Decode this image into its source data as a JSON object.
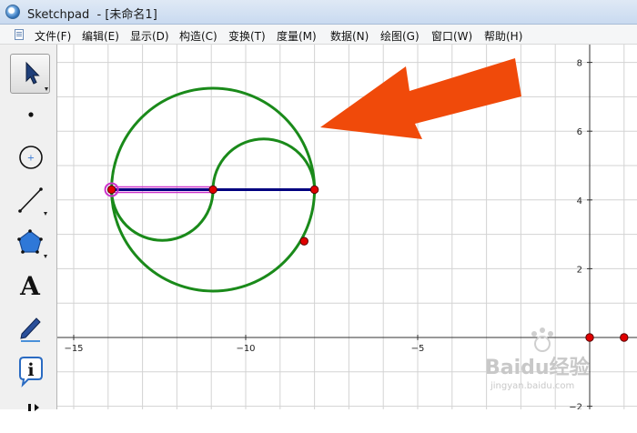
{
  "window": {
    "title": "Sketchpad  - [未命名1]"
  },
  "menu": {
    "items": [
      "文件(F)",
      "编辑(E)",
      "显示(D)",
      "构造(C)",
      "变换(T)",
      "度量(M)",
      "数据(N)",
      "绘图(G)",
      "窗口(W)",
      "帮助(H)"
    ]
  },
  "toolbox": {
    "tools": [
      {
        "name": "selection-arrow-tool",
        "icon": "arrow-icon",
        "selected": true
      },
      {
        "name": "point-tool",
        "icon": "point-icon"
      },
      {
        "name": "compass-tool",
        "icon": "circle-icon"
      },
      {
        "name": "straightedge-tool",
        "icon": "segment-icon"
      },
      {
        "name": "polygon-tool",
        "icon": "pentagon-icon"
      },
      {
        "name": "text-tool",
        "icon": "text-icon",
        "label": "A"
      },
      {
        "name": "marker-tool",
        "icon": "marker-icon"
      },
      {
        "name": "information-tool",
        "icon": "info-icon",
        "label": "i"
      },
      {
        "name": "custom-tool",
        "icon": "custom-tool-icon"
      }
    ]
  },
  "graph": {
    "x_ticks": [
      -15,
      -10,
      -5
    ],
    "x_tick_labels": [
      "−15",
      "−10",
      "−5"
    ],
    "y_ticks": [
      8,
      6,
      4,
      2,
      -2
    ],
    "y_tick_labels": [
      "8",
      "6",
      "4",
      "2",
      "−2"
    ],
    "grid": true,
    "colors": {
      "circle": "#1a8a1a",
      "segment": "#000080",
      "point": "#e00000",
      "arrow": "#f04a0a",
      "selected_highlight": "#cc33cc"
    }
  },
  "watermark": {
    "brand": "Baidu经验",
    "url": "jingyan.baidu.com"
  }
}
